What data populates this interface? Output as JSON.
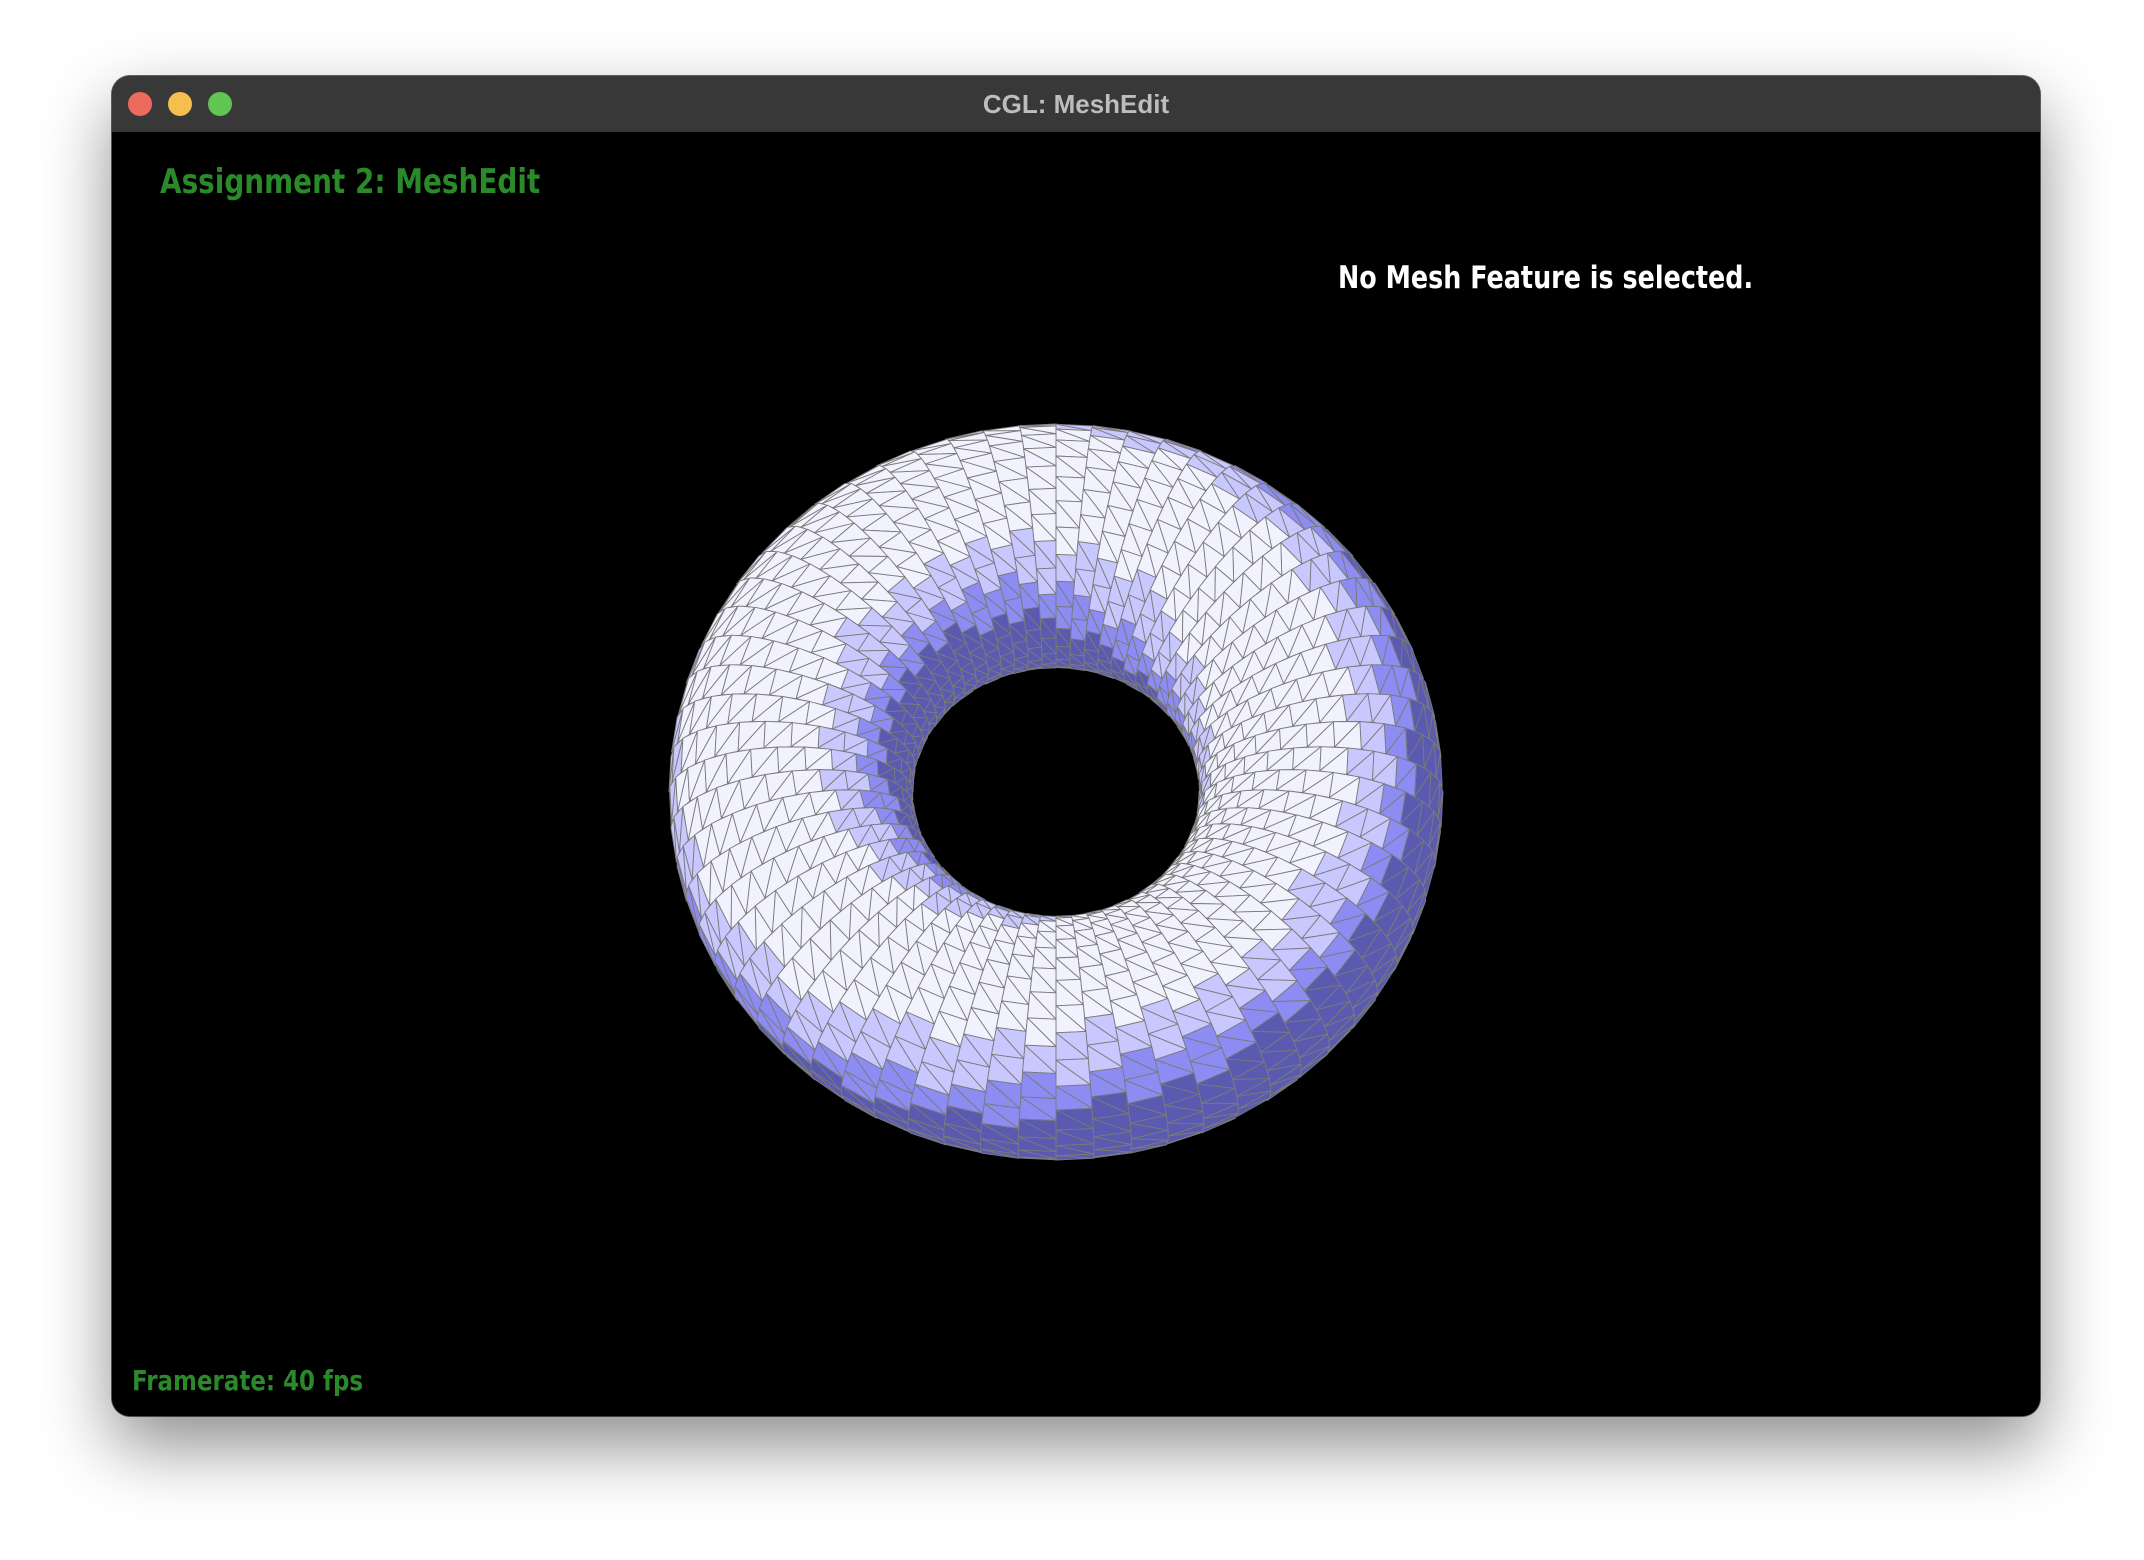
{
  "window": {
    "title": "CGL: MeshEdit",
    "traffic_lights": {
      "close_color": "#ed6a5e",
      "minimize_color": "#f5bf4f",
      "zoom_color": "#61c554"
    }
  },
  "hud": {
    "title": "Assignment 2: MeshEdit",
    "selection_status": "No Mesh Feature is selected.",
    "framerate": "Framerate: 40 fps"
  },
  "mesh": {
    "name": "torus",
    "fill_colors": [
      "#f2f2ff",
      "#c8c8ff",
      "#8c8cf2",
      "#5a5ab0"
    ],
    "wire_color": "#7a7a7a"
  },
  "colors": {
    "hud_green": "#2a8a2a",
    "status_white": "#ffffff",
    "background": "#000000"
  }
}
